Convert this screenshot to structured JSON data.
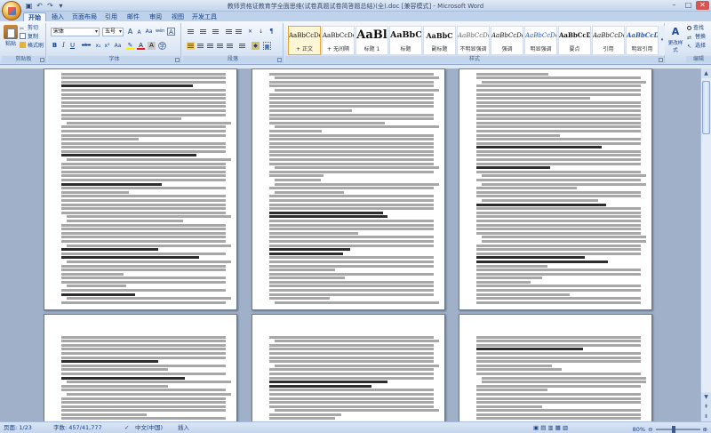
{
  "window": {
    "title": "教师资格证教育学全面思维(试卷真题试卷简答题总结)(全).doc [兼容模式] - Microsoft Word"
  },
  "tabs": [
    "开始",
    "插入",
    "页面布局",
    "引用",
    "邮件",
    "审阅",
    "视图",
    "开发工具"
  ],
  "ribbon": {
    "clipboard": {
      "paste": "粘贴",
      "cut": "剪切",
      "copy": "复制",
      "format_painter": "格式刷",
      "label": "剪贴板"
    },
    "font": {
      "family": "宋体",
      "size": "五号",
      "label": "字体",
      "bold": "B",
      "italic": "I",
      "underline": "U",
      "strike": "abe",
      "sub": "x₂",
      "sup": "x²",
      "clear": "Aa",
      "grow": "A",
      "shrink": "A",
      "phonetic": "wén",
      "border_char": "A"
    },
    "paragraph": {
      "label": "段落"
    },
    "styles": {
      "label": "样式",
      "items": [
        {
          "preview": "AaBbCcDc",
          "name": "+ 正文"
        },
        {
          "preview": "AaBbCcDc",
          "name": "+ 无间隔"
        },
        {
          "preview": "AaBl",
          "name": "标题 1"
        },
        {
          "preview": "AaBbC",
          "name": "标题"
        },
        {
          "preview": "AaBbC",
          "name": "副标题"
        },
        {
          "preview": "AaBbCcDc",
          "name": "不明显强调"
        },
        {
          "preview": "AaBbCcDc",
          "name": "强调"
        },
        {
          "preview": "AaBbCcDc",
          "name": "明显强调"
        },
        {
          "preview": "AaBbCcDc",
          "name": "要点"
        },
        {
          "preview": "AaBbCcDc",
          "name": "引用"
        },
        {
          "preview": "AaBbCcDc",
          "name": "明显引用"
        }
      ],
      "change_styles": "更改样式"
    },
    "editing": {
      "find": "查找",
      "replace": "替换",
      "select": "选择",
      "label": "编辑"
    }
  },
  "statusbar": {
    "page": "页面: 1/23",
    "words": "字数: 457/41,777",
    "language": "中文(中国)",
    "insert": "插入",
    "zoom": "80%"
  },
  "colors": {
    "ribbon_bg": "#dbe6f4",
    "tab_text": "#15428b",
    "document_bg": "#9fb0c8",
    "selected_style": "#fff6d6"
  }
}
